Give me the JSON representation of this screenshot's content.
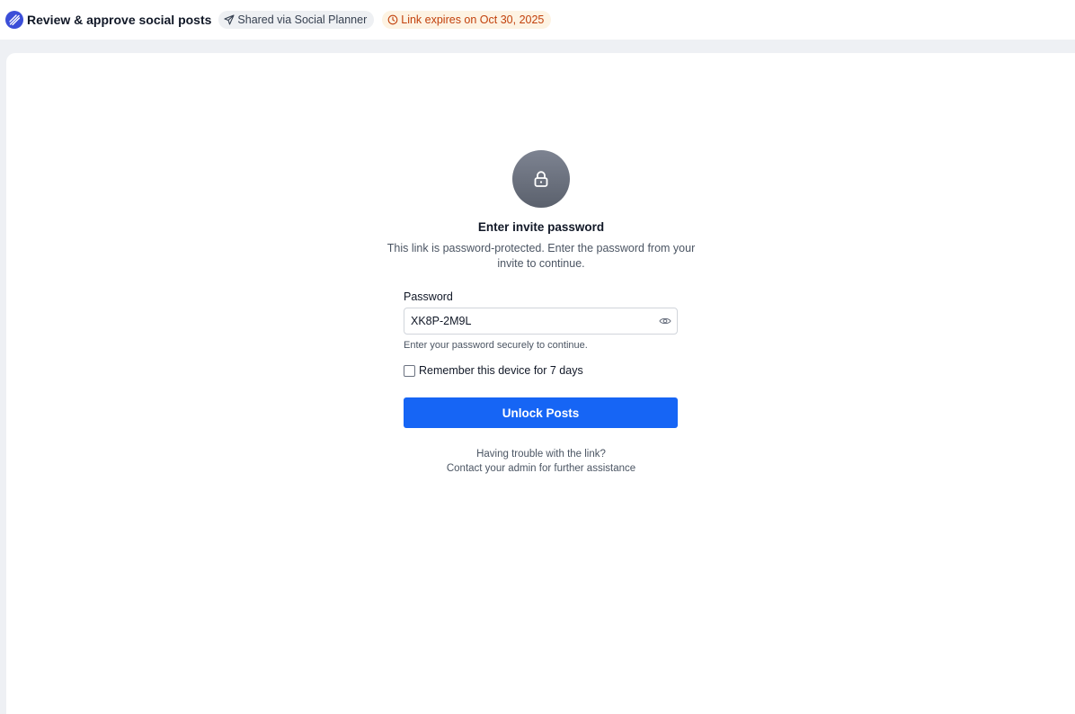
{
  "header": {
    "title": "Review & approve social posts",
    "shared_chip": "Shared via Social Planner",
    "expiry_chip": "Link expires on Oct 30, 2025"
  },
  "lock_dialog": {
    "heading": "Enter invite password",
    "description": "This link is password-protected. Enter the password from your invite to continue.",
    "password_label": "Password",
    "password_value": "XK8P‑2M9L",
    "helper_text": "Enter your password securely to continue.",
    "remember_label": "Remember this device for 7 days",
    "remember_checked": false,
    "unlock_label": "Unlock Posts",
    "trouble_line1": "Having trouble with the link?",
    "trouble_line2": "Contact your admin for further assistance"
  },
  "colors": {
    "primary": "#1665f5",
    "brand": "#3b4ed8",
    "expiry_text": "#c2410c",
    "expiry_bg": "#fdf3e3"
  },
  "icons": {
    "brand": "brand-logo-icon",
    "shared": "send-icon",
    "expiry": "clock-icon",
    "lock": "lock-icon",
    "reveal": "eye-icon"
  }
}
